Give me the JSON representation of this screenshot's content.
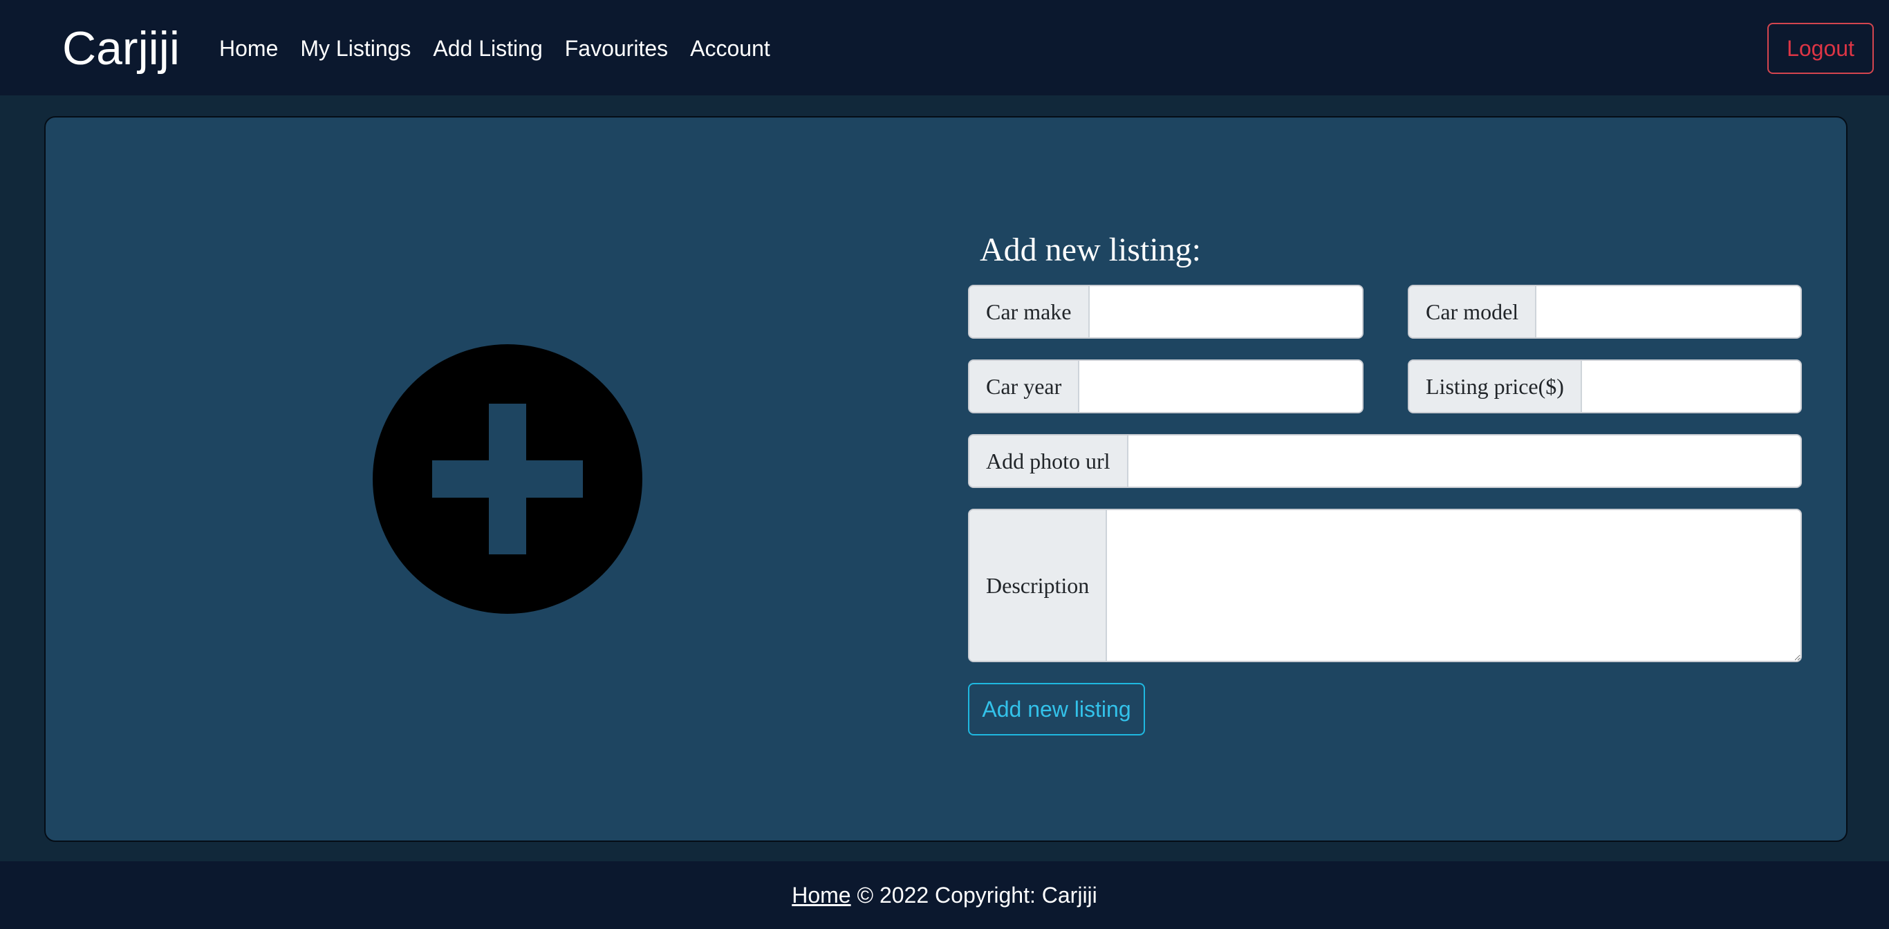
{
  "app": {
    "brand": "Carjiji"
  },
  "nav": {
    "items": [
      {
        "label": "Home"
      },
      {
        "label": "My Listings"
      },
      {
        "label": "Add Listing"
      },
      {
        "label": "Favourites"
      },
      {
        "label": "Account"
      }
    ],
    "logout_label": "Logout"
  },
  "form": {
    "title": "Add new listing:",
    "fields": {
      "car_make": {
        "label": "Car make",
        "value": ""
      },
      "car_model": {
        "label": "Car model",
        "value": ""
      },
      "car_year": {
        "label": "Car year",
        "value": ""
      },
      "listing_price": {
        "label": "Listing price($)",
        "value": ""
      },
      "photo_url": {
        "label": "Add photo url",
        "value": ""
      },
      "description": {
        "label": "Description",
        "value": ""
      }
    },
    "submit_label": "Add new listing"
  },
  "footer": {
    "home_link": "Home",
    "copyright": " © 2022 Copyright: Carjiji"
  },
  "colors": {
    "navbar_bg": "#0b182e",
    "page_bg": "#11283a",
    "card_bg": "#1e4561",
    "logout": "#dc3545",
    "submit": "#33c2ea"
  },
  "icons": {
    "add_image": "plus-circle-icon"
  }
}
